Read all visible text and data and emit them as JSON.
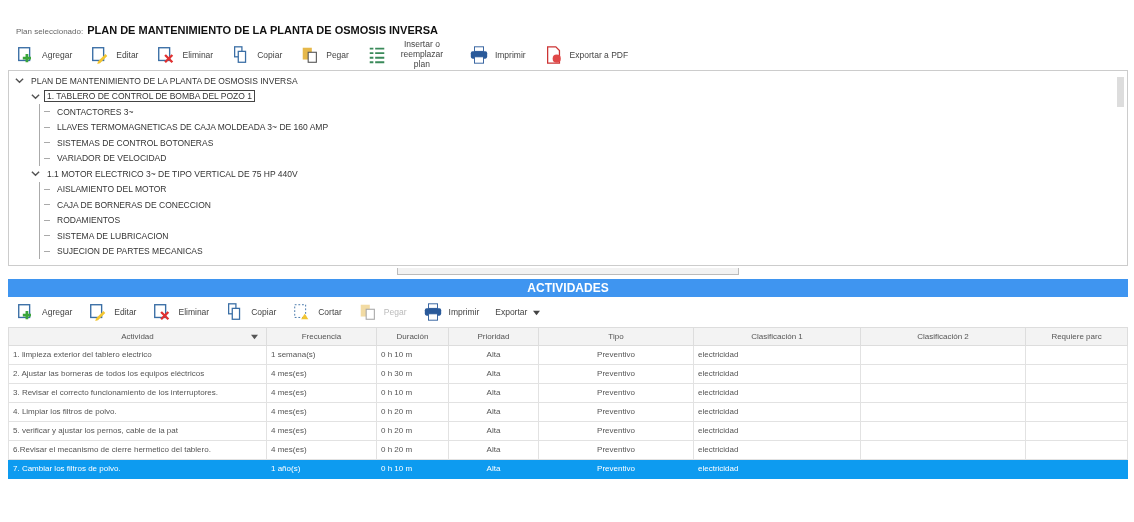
{
  "plan": {
    "label": "Plan seleccionado:",
    "name": "PLAN DE MANTENIMIENTO DE LA PLANTA DE OSMOSIS INVERSA"
  },
  "plan_toolbar": [
    {
      "kind": "add",
      "label": "Agregar",
      "disabled": false
    },
    {
      "kind": "edit",
      "label": "Editar",
      "disabled": false
    },
    {
      "kind": "delete",
      "label": "Eliminar",
      "disabled": false
    },
    {
      "kind": "copy",
      "label": "Copiar",
      "disabled": false
    },
    {
      "kind": "paste",
      "label": "Pegar",
      "disabled": false
    },
    {
      "kind": "insert",
      "label": "Insertar o reemplazar plan",
      "disabled": false
    },
    {
      "kind": "print",
      "label": "Imprimir",
      "disabled": false
    },
    {
      "kind": "pdf",
      "label": "Exportar a PDF",
      "disabled": false
    }
  ],
  "tree": [
    {
      "label": "PLAN DE MANTENIMIENTO DE LA PLANTA DE OSMOSIS INVERSA",
      "expanded": true,
      "selected": false,
      "children": [
        {
          "label": "1. TABLERO DE CONTROL DE BOMBA DEL POZO 1",
          "expanded": true,
          "selected": true,
          "children": [
            {
              "label": "CONTACTORES 3~",
              "selected": false
            },
            {
              "label": "LLAVES TERMOMAGNETICAS DE CAJA MOLDEADA 3~ DE 160 AMP",
              "selected": false
            },
            {
              "label": "SISTEMAS DE CONTROL BOTONERAS",
              "selected": false
            },
            {
              "label": "VARIADOR DE VELOCIDAD",
              "selected": false
            }
          ]
        },
        {
          "label": "1.1 MOTOR ELECTRICO 3~ DE TIPO VERTICAL DE 75 HP 440V",
          "expanded": true,
          "selected": false,
          "children": [
            {
              "label": "AISLAMIENTO DEL MOTOR",
              "selected": false
            },
            {
              "label": "CAJA DE BORNERAS DE CONECCION",
              "selected": false
            },
            {
              "label": "RODAMIENTOS",
              "selected": false
            },
            {
              "label": "SISTEMA DE LUBRICACION",
              "selected": false
            },
            {
              "label": "SUJECION DE PARTES MECANICAS",
              "selected": false
            }
          ]
        }
      ]
    }
  ],
  "activities": {
    "title": "ACTIVIDADES",
    "toolbar": [
      {
        "kind": "add",
        "label": "Agregar",
        "disabled": false
      },
      {
        "kind": "edit",
        "label": "Editar",
        "disabled": false
      },
      {
        "kind": "delete",
        "label": "Eliminar",
        "disabled": false
      },
      {
        "kind": "copy",
        "label": "Copiar",
        "disabled": false
      },
      {
        "kind": "cut",
        "label": "Cortar",
        "disabled": false
      },
      {
        "kind": "paste",
        "label": "Pegar",
        "disabled": true
      },
      {
        "kind": "print",
        "label": "Imprimir",
        "disabled": false
      },
      {
        "kind": "menu",
        "label": "Exportar",
        "disabled": false
      }
    ],
    "columns": [
      {
        "label": "Actividad",
        "sorted": true
      },
      {
        "label": "Frecuencia",
        "sorted": false
      },
      {
        "label": "Duración",
        "sorted": false
      },
      {
        "label": "Prioridad",
        "sorted": false
      },
      {
        "label": "Tipo",
        "sorted": false
      },
      {
        "label": "Clasificación 1",
        "sorted": false
      },
      {
        "label": "Clasificación 2",
        "sorted": false
      },
      {
        "label": "Requiere parc",
        "sorted": false
      }
    ],
    "rows": [
      {
        "selected": false,
        "cells": [
          "1. limpieza exterior del tablero electrico",
          "1 semana(s)",
          "0 h 10 m",
          "Alta",
          "Preventivo",
          "electricidad",
          "",
          ""
        ]
      },
      {
        "selected": false,
        "cells": [
          "2. Ajustar las borneras de todos los equipos eléctricos",
          "4 mes(es)",
          "0 h 30 m",
          "Alta",
          "Preventivo",
          "electricidad",
          "",
          ""
        ]
      },
      {
        "selected": false,
        "cells": [
          "3. Revisar el correcto funcionamiento de los interruptores.",
          "4 mes(es)",
          "0 h 10 m",
          "Alta",
          "Preventivo",
          "electricidad",
          "",
          ""
        ]
      },
      {
        "selected": false,
        "cells": [
          "4. Limpiar los filtros de polvo.",
          "4 mes(es)",
          "0 h 20 m",
          "Alta",
          "Preventivo",
          "electricidad",
          "",
          ""
        ]
      },
      {
        "selected": false,
        "cells": [
          "5. verificar y ajustar los pernos, cable de la pat",
          "4 mes(es)",
          "0 h 20 m",
          "Alta",
          "Preventivo",
          "electricidad",
          "",
          ""
        ]
      },
      {
        "selected": false,
        "cells": [
          "6.Revisar el mecanismo de cierre hermetico del tablero.",
          "4 mes(es)",
          "0 h 20 m",
          "Alta",
          "Preventivo",
          "electricidad",
          "",
          ""
        ]
      },
      {
        "selected": true,
        "cells": [
          "7. Cambiar los filtros de polvo.",
          "1 año(s)",
          "0 h 10 m",
          "Alta",
          "Preventivo",
          "electricidad",
          "",
          ""
        ]
      }
    ]
  }
}
